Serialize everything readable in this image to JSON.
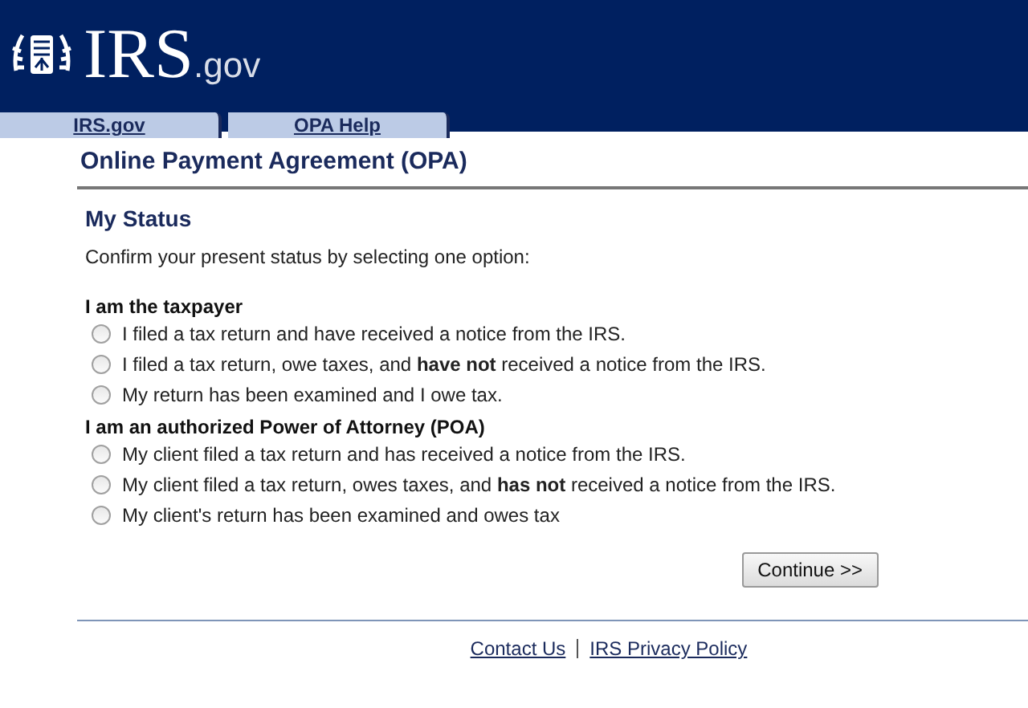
{
  "header": {
    "logo_text": "IRS",
    "logo_suffix": ".gov"
  },
  "tabs": [
    {
      "label": "IRS.gov"
    },
    {
      "label": "OPA Help"
    }
  ],
  "page_title": "Online Payment Agreement (OPA)",
  "section_title": "My Status",
  "instruction": "Confirm your present status by selecting one option:",
  "groups": [
    {
      "heading": "I am the taxpayer",
      "options": [
        {
          "label": "I filed a tax return and have received a notice from the IRS.",
          "selected": false
        },
        {
          "label": "I filed a tax return, owe taxes, and **have not** received a notice from the IRS.",
          "selected": false
        },
        {
          "label": "My return has been examined and I owe tax.",
          "selected": false
        }
      ]
    },
    {
      "heading": "I am an authorized Power of Attorney (POA)",
      "options": [
        {
          "label": "My client filed a tax return and has received a notice from the IRS.",
          "selected": false
        },
        {
          "label": "My client filed a tax return, owes taxes, and **has not** received a notice from the IRS.",
          "selected": false
        },
        {
          "label": "My client's return has been examined and owes tax",
          "selected": false
        }
      ]
    }
  ],
  "continue_button": "Continue >>",
  "footer_links": [
    "Contact Us",
    "IRS Privacy Policy"
  ]
}
